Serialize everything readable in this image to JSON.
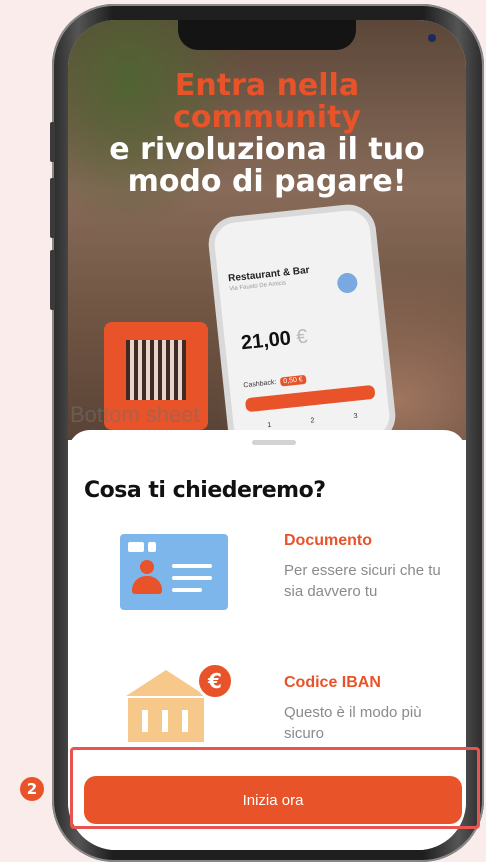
{
  "step": {
    "number": "2"
  },
  "hero": {
    "title_line1": "Entra nella",
    "title_line2": "community",
    "title_line3": "e rivoluziona il tuo",
    "title_line4": "modo di pagare!",
    "mock": {
      "restaurant": "Restaurant & Bar",
      "address": "Via Fausto De Amicis",
      "amount": "21,00",
      "currency": "€",
      "cashback_label": "Cashback:",
      "cashback_value": "0,50 €",
      "keys": [
        "1",
        "2",
        "3"
      ]
    },
    "watermark": "Bottom sheet"
  },
  "sheet": {
    "title": "Cosa ti chiederemo?",
    "items": [
      {
        "title": "Documento",
        "description": "Per essere sicuri che tu sia davvero tu",
        "icon": "id-card-icon"
      },
      {
        "title": "Codice IBAN",
        "description": "Questo è il modo più sicuro",
        "icon": "bank-euro-icon"
      }
    ],
    "cta_label": "Inizia ora",
    "euro_symbol": "€"
  },
  "colors": {
    "accent": "#e8532a",
    "highlight": "#e85550",
    "card_blue": "#7cb6ea",
    "bank_peach": "#f6c88a"
  }
}
